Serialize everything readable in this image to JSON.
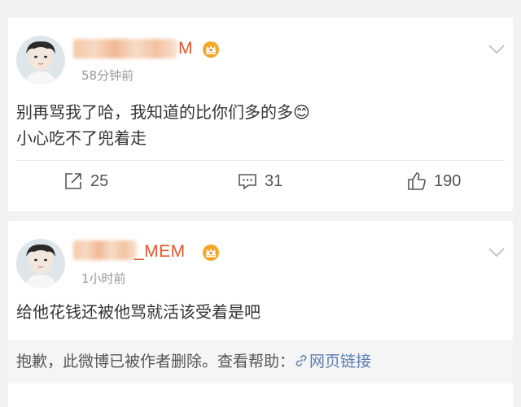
{
  "posts": [
    {
      "username_suffix": "M",
      "time": "58分钟前",
      "lines": [
        "别再骂我了哈，我知道的比你们多的多😊",
        "小心吃不了兜着走"
      ],
      "repost_count": "25",
      "comment_count": "31",
      "like_count": "190"
    },
    {
      "username_suffix": "_MEM",
      "time": "1小时前",
      "lines": [
        "给他花钱还被他骂就活该受着是吧"
      ],
      "deleted_notice": "抱歉，此微博已被作者删除。查看帮助：",
      "help_link": "网页链接"
    }
  ],
  "colors": {
    "accent_name": "#e7562b",
    "link": "#5a7fb0",
    "vip_badge": "#f5a623"
  },
  "icons": [
    "avatar",
    "vip-crown-icon",
    "chevron-down-icon",
    "repost-icon",
    "comment-icon",
    "like-icon",
    "link-icon"
  ]
}
